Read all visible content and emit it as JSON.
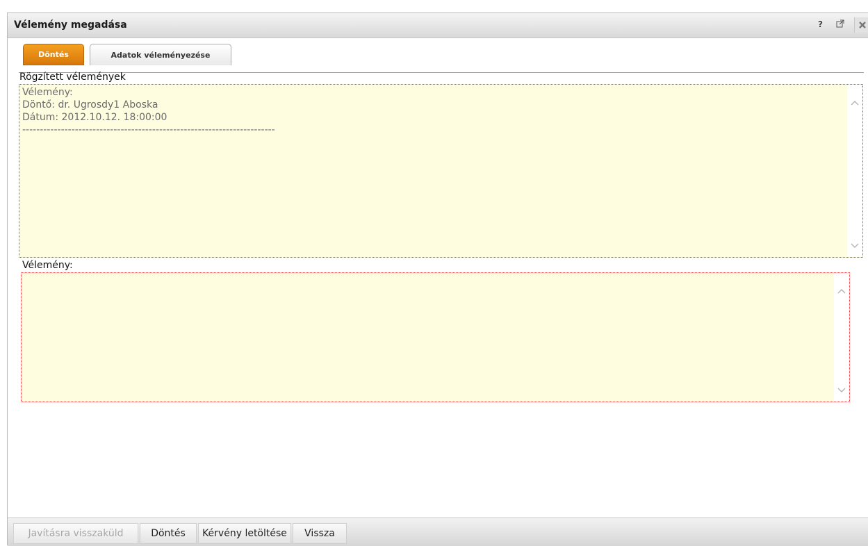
{
  "window": {
    "title": "Vélemény megadása",
    "help_icon": "?",
    "popout_icon": "popout-icon",
    "close_icon": "close-icon"
  },
  "tabs": [
    {
      "label": "Döntés",
      "active": true
    },
    {
      "label": "Adatok véleményezése",
      "active": false
    }
  ],
  "recorded": {
    "label": "Rögzített vélemények",
    "lines": [
      "Vélemény:",
      "Döntő: dr. Ugrosdy1 Aboska",
      "Dátum: 2012.10.12. 18:00:00",
      "------------------------------------------------------------------------"
    ]
  },
  "opinion": {
    "label": "Vélemény:",
    "value": ""
  },
  "buttons": {
    "return_for_correction": "Javításra visszaküld",
    "decision": "Döntés",
    "download_request": "Kérvény letöltése",
    "back": "Vissza"
  },
  "colors": {
    "accent_tab": "#e88c14",
    "textarea_bg": "#fffde0",
    "textarea_border": "#e04545"
  }
}
